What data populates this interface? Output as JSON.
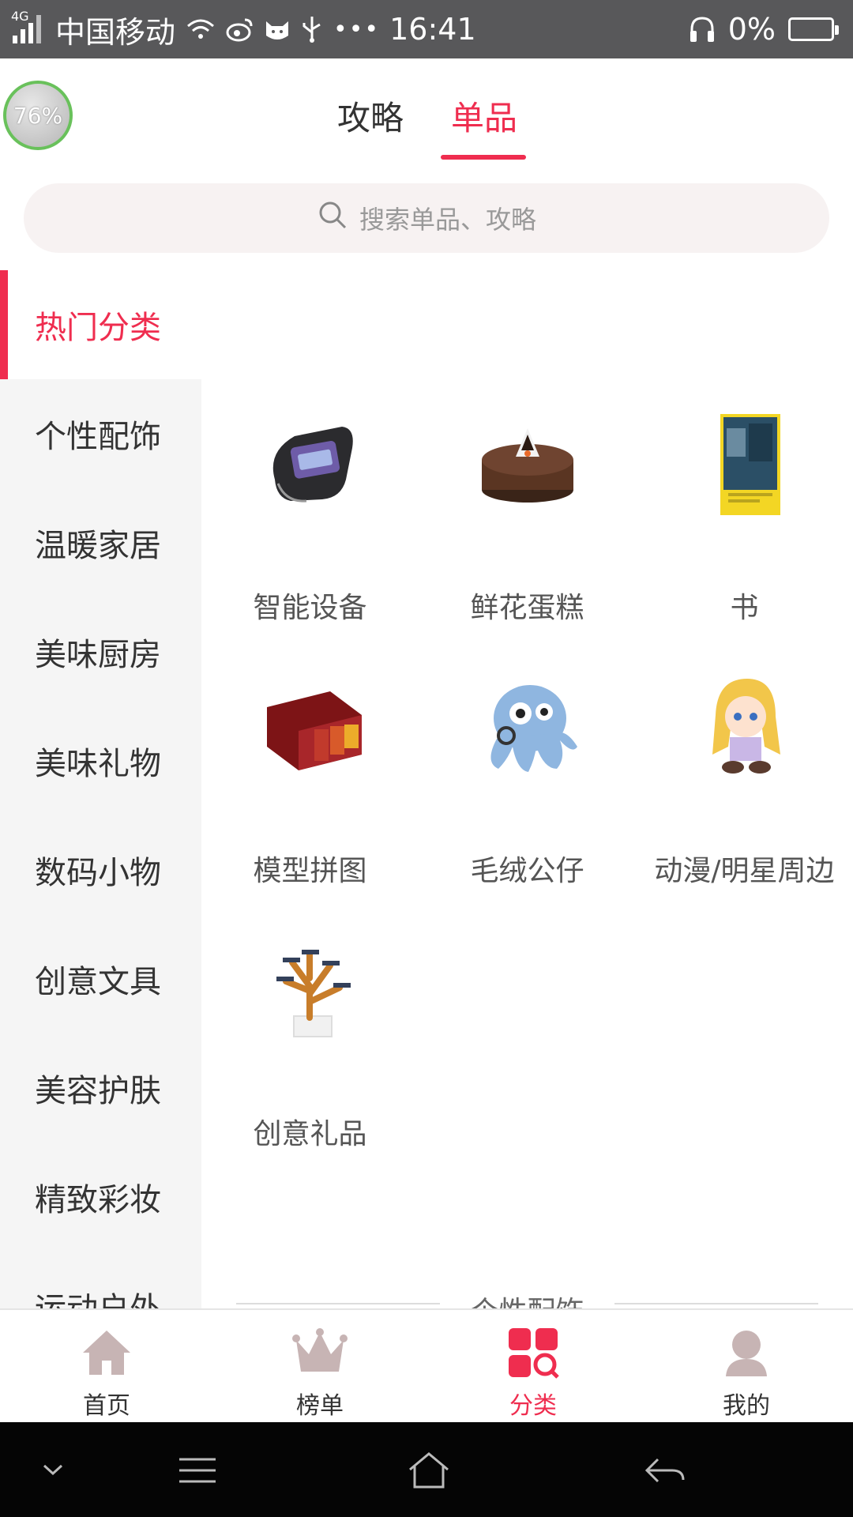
{
  "status_bar": {
    "network_type": "4G",
    "carrier": "中国移动",
    "time": "16:41",
    "battery": "0%",
    "icons": [
      "signal-icon",
      "wifi-icon",
      "weibo-icon",
      "cat-app-icon",
      "usb-icon",
      "more-dots-icon",
      "headphone-icon",
      "battery-icon"
    ]
  },
  "floating_bubble": {
    "text": "76%"
  },
  "top_tabs": [
    {
      "label": "攻略",
      "active": false
    },
    {
      "label": "单品",
      "active": true
    }
  ],
  "search": {
    "placeholder": "搜索单品、攻略",
    "icon": "search-icon"
  },
  "categories": [
    {
      "label": "热门分类",
      "active": true
    },
    {
      "label": "个性配饰"
    },
    {
      "label": "温暖家居"
    },
    {
      "label": "美味厨房"
    },
    {
      "label": "美味礼物"
    },
    {
      "label": "数码小物"
    },
    {
      "label": "创意文具"
    },
    {
      "label": "美容护肤"
    },
    {
      "label": "精致彩妆"
    },
    {
      "label": "运动户外"
    }
  ],
  "items": [
    {
      "label": "智能设备",
      "icon": "smart-band-icon"
    },
    {
      "label": "鲜花蛋糕",
      "icon": "cake-icon"
    },
    {
      "label": "书",
      "icon": "book-icon"
    },
    {
      "label": "模型拼图",
      "icon": "model-puzzle-icon"
    },
    {
      "label": "毛绒公仔",
      "icon": "plush-octopus-icon"
    },
    {
      "label": "动漫/明星周边",
      "icon": "anime-figure-icon"
    },
    {
      "label": "创意礼品",
      "icon": "creative-tree-icon"
    }
  ],
  "section_title": "个性配饰",
  "bottom_nav": [
    {
      "label": "首页",
      "icon": "home-icon",
      "active": false
    },
    {
      "label": "榜单",
      "icon": "crown-icon",
      "active": false
    },
    {
      "label": "分类",
      "icon": "category-icon",
      "active": true
    },
    {
      "label": "我的",
      "icon": "profile-icon",
      "active": false
    }
  ],
  "colors": {
    "accent": "#ef2d4f",
    "nav_icon": "#c7b4b4",
    "status_bar": "#58585a"
  }
}
